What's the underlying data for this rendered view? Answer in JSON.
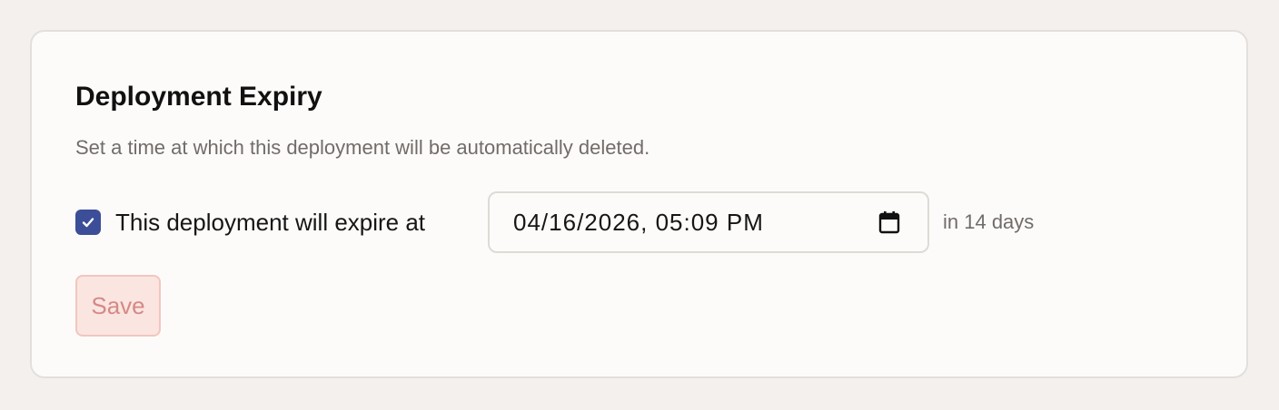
{
  "card": {
    "title": "Deployment Expiry",
    "description": "Set a time at which this deployment will be automatically deleted."
  },
  "expiry": {
    "checkbox_checked": true,
    "checkbox_icon": "check-icon",
    "label": "This deployment will expire at",
    "datetime_value": "04/16/2026, 05:09 PM",
    "calendar_icon": "calendar-icon",
    "relative": "in 14 days"
  },
  "actions": {
    "save_label": "Save",
    "save_disabled": true
  },
  "colors": {
    "page_background": "#f4f0ed",
    "card_background": "#fdfbf9",
    "checkbox_accent": "#3c4e98",
    "save_background": "#fbe5e0",
    "save_text": "#d48a87",
    "muted_text": "#716c69"
  }
}
